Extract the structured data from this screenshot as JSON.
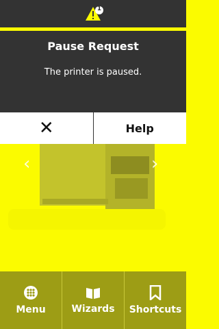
{
  "dialog": {
    "title": "Pause Request",
    "message": "The printer is paused.",
    "alert_count": "1",
    "close_icon": "close-icon",
    "help_label": "Help"
  },
  "nav": {
    "items": [
      {
        "label": "Menu",
        "icon": "menu-grid-icon"
      },
      {
        "label": "Wizards",
        "icon": "book-icon"
      },
      {
        "label": "Shortcuts",
        "icon": "bookmark-icon"
      }
    ]
  },
  "colors": {
    "accent": "#fbfb00",
    "dialog_bg": "#333333",
    "nav_bg": "#9d9d15"
  }
}
